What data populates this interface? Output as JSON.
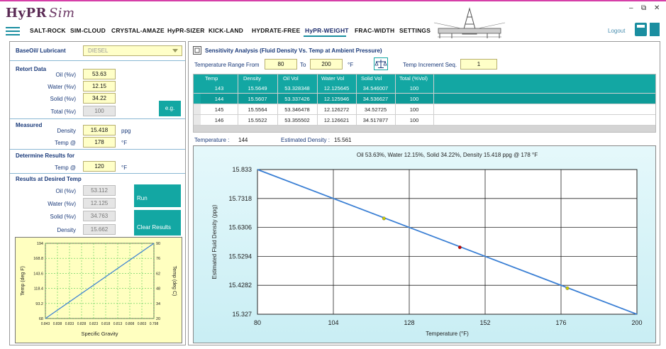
{
  "app": {
    "logo_main": "HyPR",
    "logo_sub": "Sim",
    "window_min": "–",
    "window_restore": "⧉",
    "window_close": "✕"
  },
  "menu": {
    "items": [
      "SALT-ROCK",
      "SIM-CLOUD",
      "CRYSTAL-AMAZE",
      "HyPR-SIZER",
      "KICK-LAND",
      "HYDRATE-FREE",
      "HyPR-WEIGHT",
      "FRAC-WIDTH",
      "SETTINGS"
    ],
    "active": "HyPR-WEIGHT",
    "logout": "Logout"
  },
  "left": {
    "base_oil_label": "BaseOil/ Lubricant",
    "base_oil_value": "DIESEL",
    "retort_title": "Retort Data",
    "oil_label": "Oil (%v)",
    "oil_value": "53.63",
    "water_label": "Water (%v)",
    "water_value": "12.15",
    "solid_label": "Solid (%v)",
    "solid_value": "34.22",
    "total_label": "Total (%v)",
    "total_value": "100",
    "eg_button": "e.g.",
    "measured_title": "Measured",
    "density_label": "Density",
    "density_value": "15.418",
    "density_unit": "ppg",
    "temp_label": "Temp @",
    "temp_value": "178",
    "temp_unit": "°F",
    "determine_title": "Determine Results for",
    "det_temp_label": "Temp @",
    "det_temp_value": "120",
    "det_temp_unit": "°F",
    "results_title": "Results at Desired Temp",
    "r_oil_label": "Oil (%v)",
    "r_oil_value": "53.112",
    "r_water_label": "Water (%v)",
    "r_water_value": "12.125",
    "r_solid_label": "Solid (%v)",
    "r_solid_value": "34.763",
    "r_density_label": "Density",
    "r_density_value": "15.662",
    "run_button": "Run",
    "clear_button": "Clear Results"
  },
  "right": {
    "title": "Sensitivity Analysis (Fluid Density Vs. Temp at Ambient Pressure)",
    "range_from_label": "Temperature Range From",
    "range_from_value": "80",
    "to_label": "To",
    "range_to_value": "200",
    "range_unit": "°F",
    "increment_label": "Temp Increment Seq.",
    "increment_value": "1",
    "table": {
      "columns": [
        "Temp",
        "Density",
        "Oil Vol",
        "Water Vol",
        "Solid Vol",
        "Total (%Vol)"
      ],
      "rows": [
        [
          "143",
          "15.5649",
          "53.328348",
          "12.125645",
          "34.546007",
          "100"
        ],
        [
          "144",
          "15.5607",
          "53.337426",
          "12.125946",
          "34.536627",
          "100"
        ],
        [
          "145",
          "15.5564",
          "53.346478",
          "12.126272",
          "34.52725",
          "100"
        ],
        [
          "146",
          "15.5522",
          "53.355502",
          "12.126621",
          "34.517877",
          "100"
        ]
      ]
    },
    "status_temp_label": "Temperature :",
    "status_temp_value": "144",
    "status_density_label": "Estimated Density :",
    "status_density_value": "15.561"
  },
  "chart_data": [
    {
      "type": "line",
      "title": "Oil 53.63%, Water 12.15%, Solid 34.22%, Density 15.418 ppg @ 178 °F",
      "xlabel": "Temperature (°F)",
      "ylabel": "Estimated Fluid Density (ppg)",
      "xlim": [
        80,
        200
      ],
      "ylim": [
        15.327,
        15.833
      ],
      "x_ticks": [
        "80",
        "104",
        "128",
        "152",
        "176",
        "200"
      ],
      "y_ticks": [
        "15.327",
        "15.4282",
        "15.5294",
        "15.6306",
        "15.7318",
        "15.833"
      ],
      "grid": true,
      "series": [
        {
          "x": [
            80,
            200
          ],
          "y": [
            15.833,
            15.327
          ]
        }
      ],
      "markers": [
        {
          "x": 120,
          "y": 15.662,
          "color": "#c8c800"
        },
        {
          "x": 144,
          "y": 15.561,
          "color": "#cc0000"
        },
        {
          "x": 178,
          "y": 15.418,
          "color": "#c8c800"
        }
      ],
      "line_color": "#3a7fd4"
    },
    {
      "type": "line",
      "xlabel": "Specific Gravity",
      "ylabel_left": "Temp (deg F)",
      "ylabel_right": "Temp (deg C)",
      "x_ticks": [
        "0.843",
        "0.838",
        "0.833",
        "0.828",
        "0.823",
        "0.818",
        "0.813",
        "0.808",
        "0.803",
        "0.798"
      ],
      "y_ticks_left": [
        "68",
        "93.2",
        "118.4",
        "143.6",
        "168.8",
        "194"
      ],
      "y_ticks_right": [
        "20",
        "34",
        "48",
        "62",
        "76",
        "90"
      ],
      "xlim": [
        0.843,
        0.798
      ],
      "ylim": [
        68,
        194
      ],
      "grid": true,
      "series": [
        {
          "x": [
            0.843,
            0.8205,
            0.798
          ],
          "y": [
            68,
            131,
            194
          ]
        }
      ],
      "line_color": "#3a7fd4"
    }
  ]
}
